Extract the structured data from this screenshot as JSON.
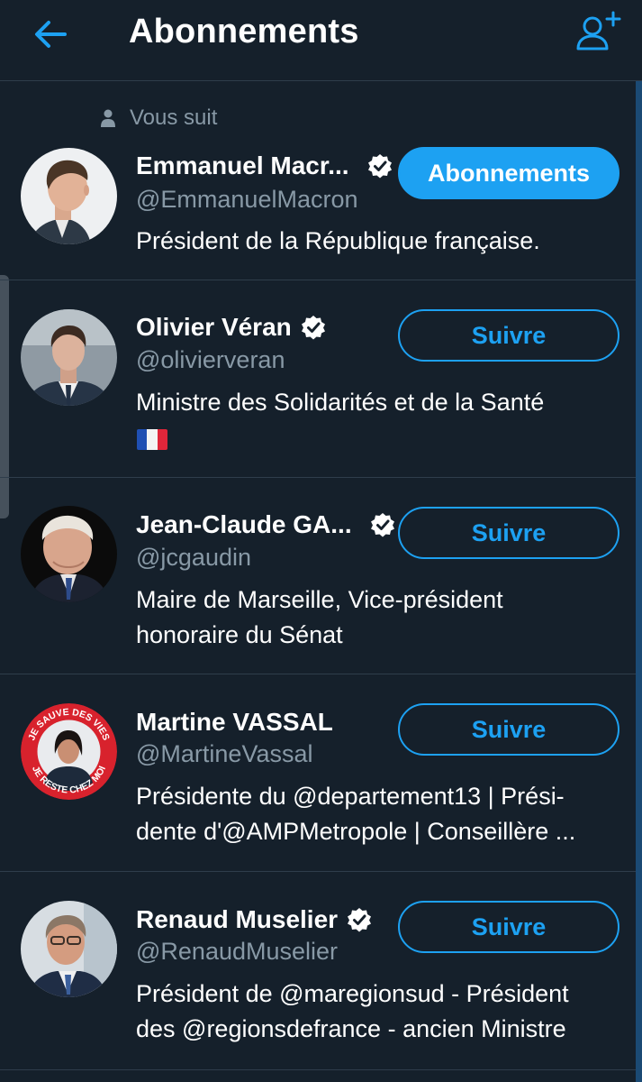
{
  "header": {
    "title": "Abonnements",
    "back_icon": "arrow-left-icon",
    "add_icon": "add-user-icon"
  },
  "colors": {
    "background": "#15202b",
    "accent": "#1da1f2",
    "secondary_text": "#8899a6",
    "divider": "#2f3d4b"
  },
  "users": [
    {
      "follows_you_label": "Vous suit",
      "name": "Emmanuel Macr...",
      "verified": true,
      "handle": "@EmmanuelMacron",
      "bio_lines": [
        "Président de la République française."
      ],
      "button_label": "Abonnements",
      "following": true
    },
    {
      "name": "Olivier Véran",
      "verified": true,
      "handle": "@olivierveran",
      "bio_lines": [
        "Ministre des Solidarités et de la Santé"
      ],
      "bio_emoji": "french-flag",
      "button_label": "Suivre",
      "following": false
    },
    {
      "name": "Jean-Claude GA...",
      "verified": true,
      "handle": "@jcgaudin",
      "bio_lines": [
        "Maire de Marseille, Vice-président",
        "honoraire du Sénat"
      ],
      "button_label": "Suivre",
      "following": false
    },
    {
      "name": "Martine VASSAL",
      "verified": false,
      "handle": "@MartineVassal",
      "bio_lines": [
        "Présidente du @departement13 | Prési-",
        "dente d'@AMPMetropole | Conseillère ..."
      ],
      "avatar_ring_text_top": "JE SAUVE DES VIES",
      "avatar_ring_text_bottom": "JE RESTE CHEZ MOI",
      "button_label": "Suivre",
      "following": false
    },
    {
      "name": "Renaud Muselier",
      "verified": true,
      "handle": "@RenaudMuselier",
      "bio_lines": [
        "Président de @maregionsud - Président",
        "des @regionsdefrance - ancien Ministre"
      ],
      "button_label": "Suivre",
      "following": false
    }
  ]
}
